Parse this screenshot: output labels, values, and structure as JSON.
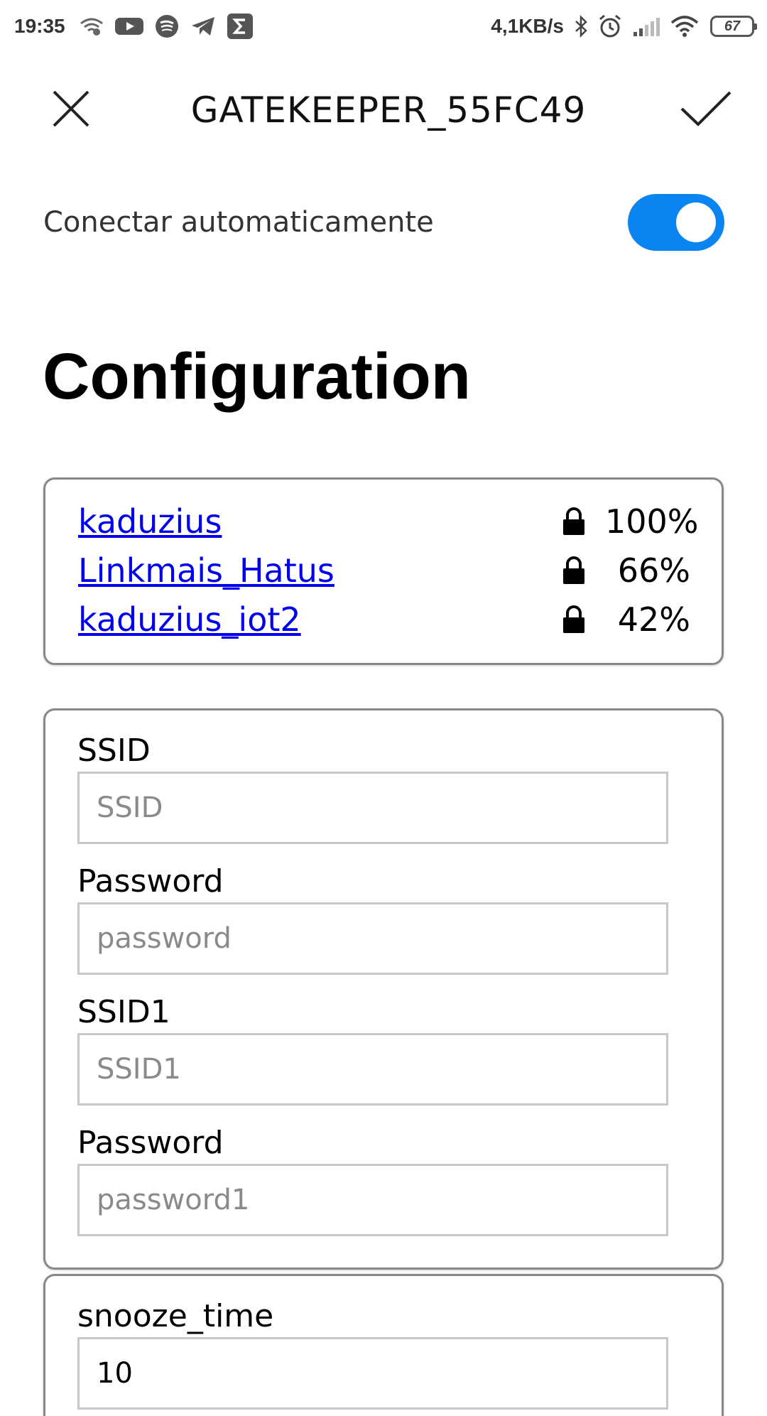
{
  "status_bar": {
    "time": "19:35",
    "left_icons": [
      "wifi-hotspot-icon",
      "youtube-icon",
      "spotify-icon",
      "telegram-icon",
      "sigma-app-icon"
    ],
    "net_speed": "4,1KB/s",
    "right_icons": [
      "bluetooth-icon",
      "alarm-icon",
      "cell-signal-icon",
      "wifi-icon"
    ],
    "battery": "67"
  },
  "header": {
    "title": "GATEKEEPER_55FC49"
  },
  "auto_connect": {
    "label": "Conectar automaticamente",
    "enabled": true,
    "accent": "#0a84f0"
  },
  "page": {
    "heading": "Configuration"
  },
  "networks": [
    {
      "name": "kaduzius",
      "signal": "100%"
    },
    {
      "name": "Linkmais_Hatus",
      "signal": "66%"
    },
    {
      "name": "kaduzius_iot2",
      "signal": "42%"
    }
  ],
  "form": {
    "ssid": {
      "label": "SSID",
      "placeholder": "SSID",
      "value": ""
    },
    "password": {
      "label": "Password",
      "placeholder": "password",
      "value": ""
    },
    "ssid1": {
      "label": "SSID1",
      "placeholder": "SSID1",
      "value": ""
    },
    "password1": {
      "label": "Password",
      "placeholder": "password1",
      "value": ""
    }
  },
  "snooze": {
    "label": "snooze_time",
    "value": "10"
  }
}
